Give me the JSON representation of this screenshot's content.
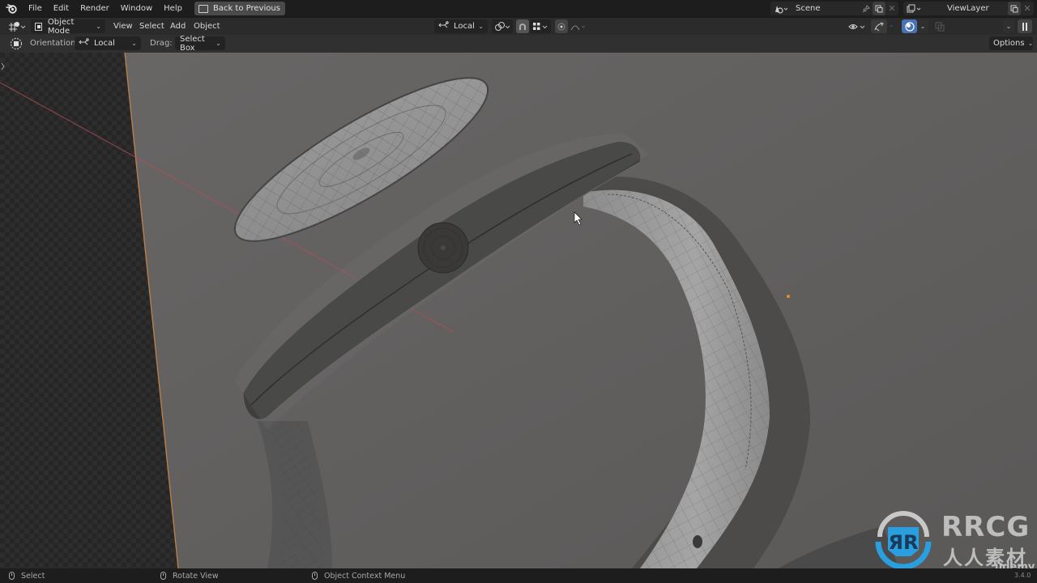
{
  "topbar": {
    "menus": [
      "File",
      "Edit",
      "Render",
      "Window",
      "Help"
    ],
    "back_button": "Back to Previous",
    "scene": {
      "name": "Scene"
    },
    "view_layer": {
      "name": "ViewLayer"
    }
  },
  "header": {
    "editor_type_icon": "3d-viewport-icon",
    "mode": "Object Mode",
    "menus": [
      "View",
      "Select",
      "Add",
      "Object"
    ],
    "transform_orientation": "Local",
    "options_label": "Options"
  },
  "tool_settings": {
    "orientation_label": "Orientation:",
    "orientation_value": "Local",
    "drag_label": "Drag:",
    "drag_value": "Select Box"
  },
  "viewport": {
    "shading_mode": "rendered",
    "xray_enabled": true,
    "objects": [
      "watch-glass",
      "watch-case",
      "watch-crown",
      "watch-strap"
    ]
  },
  "statusbar": {
    "items": [
      {
        "label": "Select",
        "icon": "mouse-left-icon"
      },
      {
        "label": "Rotate View",
        "icon": "mouse-middle-icon"
      },
      {
        "label": "Object Context Menu",
        "icon": "mouse-right-icon"
      }
    ],
    "version": "3.4.0"
  },
  "watermarks": {
    "brand": "RRCG",
    "brand_sub": "人人素材",
    "udemy": "ûdemy"
  },
  "colors": {
    "accent_blue": "#4772b3",
    "rrcg_blue": "#2a9fe0",
    "axis_red": "#b54d55",
    "selection_orange": "#e8902e"
  }
}
